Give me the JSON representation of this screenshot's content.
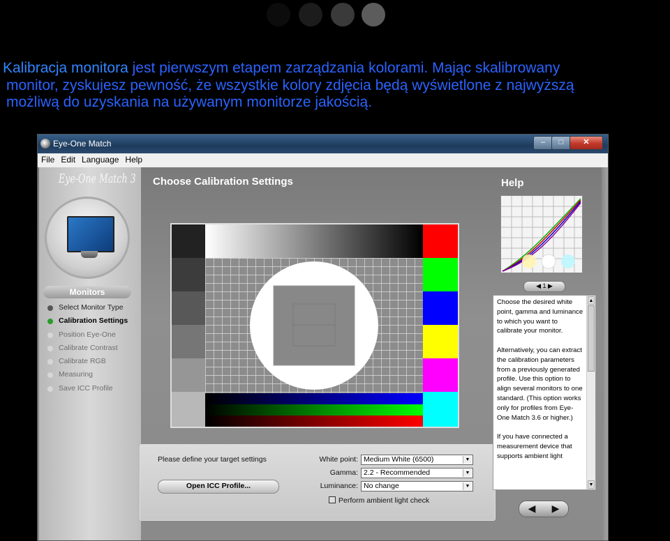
{
  "intro": {
    "highlight": "Kalibracja monitora",
    "line1_rest": " jest pierwszym etapem zarządzania kolorami. Mając skalibrowany",
    "line2": "monitor, zyskujesz pewność, że wszystkie kolory zdjęcia będą wyświetlone z najwyższą",
    "line3": "możliwą do uzyskania na używanym monitorze jakością."
  },
  "slider_dots": {
    "count": 4,
    "colors": [
      "#0c0c0c",
      "#1c1c1c",
      "#3a3a3a",
      "#5c5c5c"
    ]
  },
  "window": {
    "title": "Eye-One Match",
    "controls": {
      "minimize": "–",
      "maximize": "□",
      "close": "✕"
    },
    "menu": [
      "File",
      "Edit",
      "Language",
      "Help"
    ]
  },
  "sidebar": {
    "logo": "Eye-One Match 3",
    "section": "Monitors",
    "steps": [
      {
        "label": "Select Monitor Type",
        "state": "done"
      },
      {
        "label": "Calibration Settings",
        "state": "current"
      },
      {
        "label": "Position Eye-One",
        "state": "todo"
      },
      {
        "label": "Calibrate Contrast",
        "state": "todo"
      },
      {
        "label": "Calibrate RGB",
        "state": "todo"
      },
      {
        "label": "Measuring",
        "state": "todo"
      },
      {
        "label": "Save ICC Profile",
        "state": "todo"
      }
    ]
  },
  "main": {
    "heading": "Choose Calibration Settings",
    "prompt": "Please define your target settings",
    "open_button": "Open ICC Profile...",
    "fields": {
      "white_point": {
        "label": "White point:",
        "value": "Medium White (6500)"
      },
      "gamma": {
        "label": "Gamma:",
        "value": "2.2 - Recommended"
      },
      "luminance": {
        "label": "Luminance:",
        "value": "No change"
      }
    },
    "ambient_check": "Perform ambient light check"
  },
  "help": {
    "heading": "Help",
    "pager": "1",
    "paragraphs": [
      "Choose the desired white point, gamma and luminance to which you want to calibrate your monitor.",
      "Alternatively, you can extract the calibration parameters from a previously generated profile. Use this option to align several monitors to one standard. (This option works only for profiles from Eye-One Match 3.6 or higher.)",
      "If you have connected a measurement device that supports ambient light"
    ]
  },
  "colors": {
    "intro_text": "#2a63ff",
    "intro_highlight": "#2f86ff",
    "current_step": "#2a9a2a"
  }
}
